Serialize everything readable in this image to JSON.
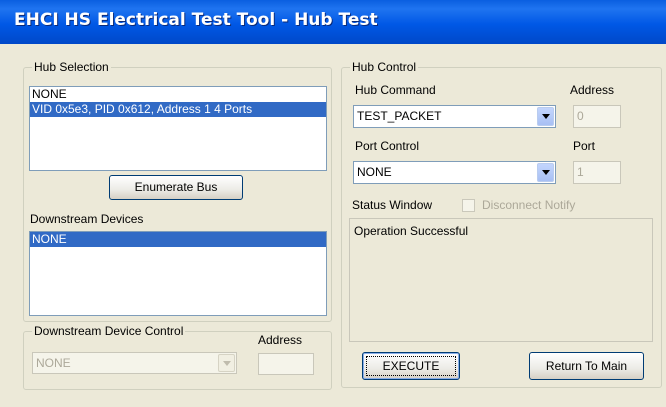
{
  "window": {
    "title": "EHCI HS Electrical Test Tool - Hub Test"
  },
  "hub_selection": {
    "legend": "Hub Selection",
    "items": [
      "NONE",
      "VID 0x5e3, PID 0x612, Address 1  4 Ports"
    ],
    "selected_index": 1,
    "enumerate_button": "Enumerate Bus",
    "downstream_label": "Downstream Devices",
    "downstream_items": [
      "NONE"
    ],
    "downstream_selected_index": 0
  },
  "downstream_device_control": {
    "legend": "Downstream Device Control",
    "address_label": "Address",
    "select_value": "NONE",
    "address_value": ""
  },
  "hub_control": {
    "legend": "Hub Control",
    "hub_command_label": "Hub Command",
    "hub_command_value": "TEST_PACKET",
    "address_label": "Address",
    "address_value": "0",
    "port_control_label": "Port Control",
    "port_control_value": "NONE",
    "port_label": "Port",
    "port_value": "1",
    "status_window_label": "Status Window",
    "disconnect_notify_label": "Disconnect Notify",
    "status_text": "Operation Successful",
    "execute_button": "EXECUTE",
    "return_button": "Return To Main"
  },
  "icons": {
    "dropdown": "chevron-down-icon",
    "checkbox": "checkbox-icon"
  }
}
